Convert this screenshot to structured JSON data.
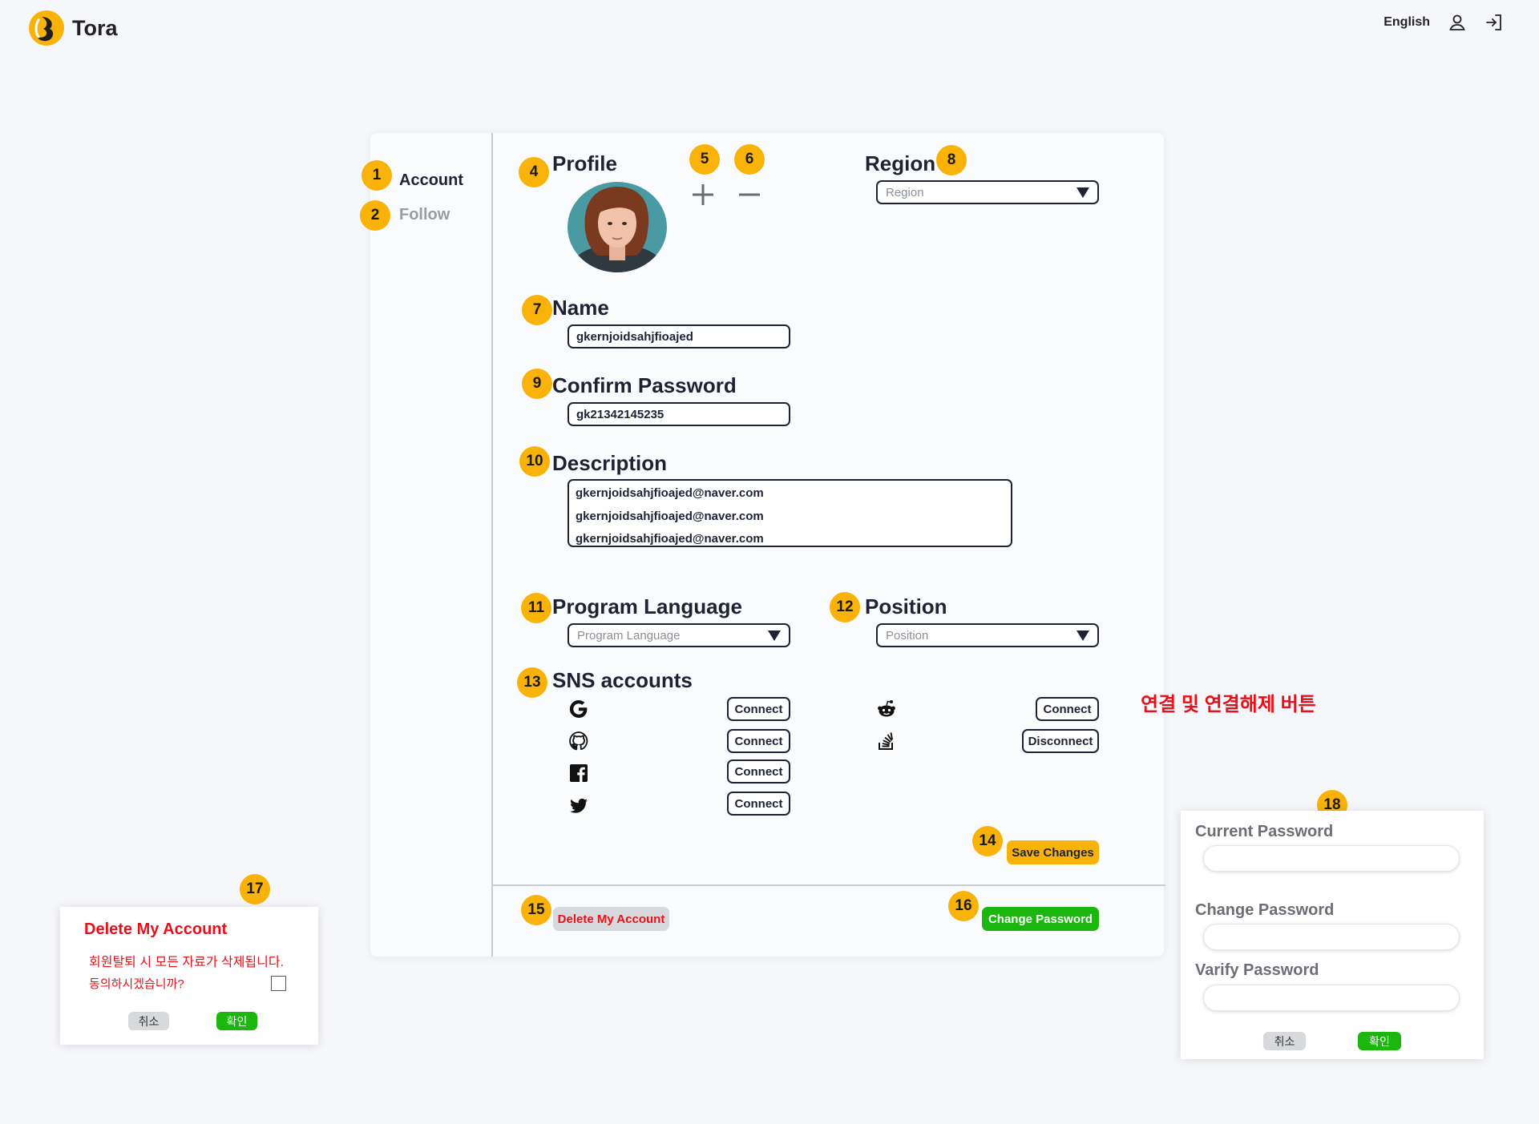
{
  "header": {
    "brand": "Tora",
    "language": "English",
    "icons": [
      "user-icon",
      "login-icon"
    ]
  },
  "sidebar": {
    "items": [
      {
        "label": "Account",
        "active": true
      },
      {
        "label": "Follow",
        "active": false
      }
    ]
  },
  "badges": [
    "1",
    "2",
    "4",
    "5",
    "6",
    "7",
    "8",
    "9",
    "10",
    "11",
    "12",
    "13",
    "14",
    "15",
    "16",
    "17",
    "18"
  ],
  "profile": {
    "heading": "Profile"
  },
  "region": {
    "heading": "Region",
    "placeholder": "Region"
  },
  "name": {
    "heading": "Name",
    "value": "gkernjoidsahjfioajed"
  },
  "confirm_password": {
    "heading": "Confirm Password",
    "value": "gk21342145235"
  },
  "description": {
    "heading": "Description",
    "lines": [
      "gkernjoidsahjfioajed@naver.com",
      "gkernjoidsahjfioajed@naver.com",
      "gkernjoidsahjfioajed@naver.com"
    ]
  },
  "program_language": {
    "heading": "Program Language",
    "placeholder": "Program Language"
  },
  "position": {
    "heading": "Position",
    "placeholder": "Position"
  },
  "sns": {
    "heading": "SNS accounts",
    "accounts": [
      {
        "icon": "google-icon",
        "button": "Connect"
      },
      {
        "icon": "github-icon",
        "button": "Connect"
      },
      {
        "icon": "facebook-icon",
        "button": "Connect"
      },
      {
        "icon": "twitter-icon",
        "button": "Connect"
      },
      {
        "icon": "reddit-icon",
        "button": "Connect"
      },
      {
        "icon": "stackoverflow-icon",
        "button": "Disconnect"
      }
    ],
    "note": "연결 및 연결해제 버튼"
  },
  "actions": {
    "save": "Save Changes",
    "delete": "Delete My Account",
    "change_password": "Change Password"
  },
  "delete_dialog": {
    "title": "Delete My Account",
    "line1": "회원탈퇴 시 모든 자료가 삭제됩니다.",
    "line2": "동의하시겠습니까?",
    "cancel": "취소",
    "confirm": "확인"
  },
  "password_dialog": {
    "current_label": "Current  Password",
    "change_label": "Change Password",
    "verify_label": "Varify Password",
    "cancel": "취소",
    "confirm": "확인"
  },
  "colors": {
    "accent": "#f9b208",
    "danger": "#e8101a",
    "success": "#1bb70f",
    "text": "#1d2333"
  }
}
